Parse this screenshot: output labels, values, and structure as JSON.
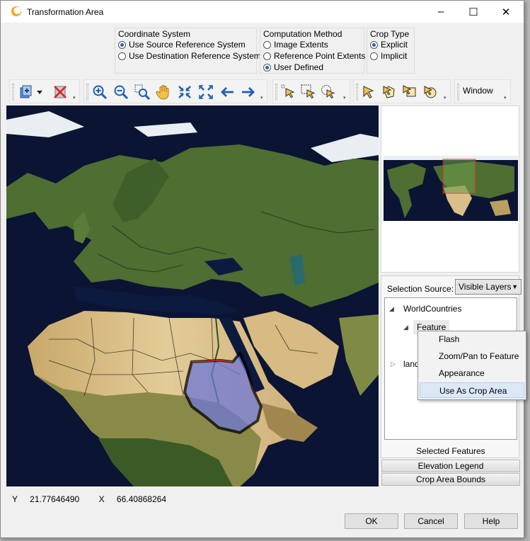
{
  "window": {
    "title": "Transformation Area",
    "controls": {
      "minimize": "–",
      "maximize": "☐",
      "close": "✕"
    }
  },
  "coordinate_system": {
    "title": "Coordinate System",
    "options": [
      {
        "label": "Use Source Reference System",
        "selected": true
      },
      {
        "label": "Use Destination Reference System",
        "selected": false
      }
    ]
  },
  "computation_method": {
    "title": "Computation Method",
    "options": [
      {
        "label": "Image Extents",
        "selected": false
      },
      {
        "label": "Reference Point Extents",
        "selected": false
      },
      {
        "label": "User Defined",
        "selected": true
      }
    ]
  },
  "crop_type": {
    "title": "Crop Type",
    "options": [
      {
        "label": "Explicit",
        "selected": true
      },
      {
        "label": "Implicit",
        "selected": false
      }
    ]
  },
  "toolbar": {
    "window_label": "Window",
    "tools": [
      "add-layer-icon",
      "dropdown-arrow-icon",
      "remove-layer-icon",
      "zoom-in-icon",
      "zoom-out-icon",
      "zoom-box-icon",
      "pan-hand-icon",
      "zoom-to-fit-icon",
      "zoom-to-full-icon",
      "back-arrow-icon",
      "forward-arrow-icon",
      "select-pointer-icon",
      "select-box-icon",
      "select-lasso-icon",
      "feature-select-icon",
      "feature-edit-icon",
      "feature-vertex-icon",
      "feature-rotate-icon"
    ]
  },
  "selection": {
    "source_label": "Selection Source:",
    "source_value": "Visible Layers",
    "tree": {
      "layer": "WorldCountries",
      "feature": "Feature",
      "collapsed_layer": "land"
    },
    "context_menu": [
      "Flash",
      "Zoom/Pan to Feature",
      "Appearance",
      "Use As Crop Area"
    ],
    "context_menu_highlighted": "Use As Crop Area",
    "panel_tabs": [
      "Selected Features",
      "Elevation Legend",
      "Crop Area Bounds"
    ]
  },
  "status": {
    "y_label": "Y",
    "y_value": "21.77646490",
    "x_label": "X",
    "x_value": "66.40868264"
  },
  "buttons": {
    "ok": "OK",
    "cancel": "Cancel",
    "help": "Help"
  },
  "colors": {
    "ocean": "#0b1433",
    "land_green": "#4a6a2e",
    "desert": "#d9c08a",
    "crop_fill": "#6e78d8",
    "crop_stroke": "#ff2020",
    "highlight": "#dbe8f8"
  }
}
